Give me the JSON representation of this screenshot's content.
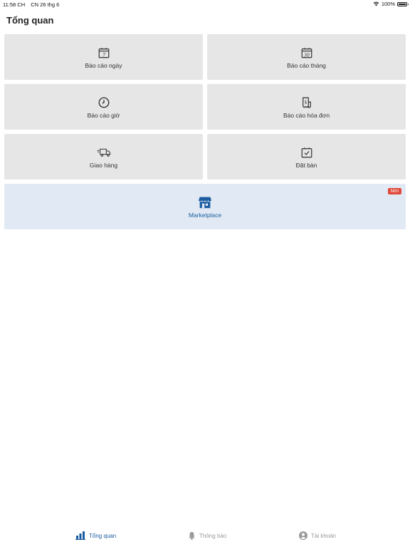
{
  "status_bar": {
    "time": "11:58 CH",
    "date": "CN 26 thg 6",
    "battery": "100%",
    "battery_level": 1.0
  },
  "page": {
    "title": "Tổng quan"
  },
  "tiles": [
    {
      "label": "Báo cáo ngày",
      "icon": "calendar-day-icon"
    },
    {
      "label": "Báo cáo tháng",
      "icon": "calendar-month-icon"
    },
    {
      "label": "Báo cáo giờ",
      "icon": "clock-icon"
    },
    {
      "label": "Báo cáo hóa đơn",
      "icon": "receipt-icon"
    },
    {
      "label": "Giao hàng",
      "icon": "delivery-truck-icon"
    },
    {
      "label": "Đặt bàn",
      "icon": "calendar-check-icon"
    }
  ],
  "marketplace": {
    "label": "Marketplace",
    "badge": "Mới",
    "icon": "store-icon"
  },
  "tab_bar": {
    "items": [
      {
        "label": "Tổng quan",
        "icon": "bar-chart-icon",
        "active": true
      },
      {
        "label": "Thông báo",
        "icon": "bell-icon",
        "active": false
      },
      {
        "label": "Tài khoản",
        "icon": "account-circle-icon",
        "active": false
      }
    ]
  },
  "colors": {
    "accent": "#1b5da0",
    "tile_bg": "#e6e6e6",
    "marketplace_bg": "#e1eaf4",
    "badge": "#e0483a",
    "inactive": "#9a9a9a"
  }
}
